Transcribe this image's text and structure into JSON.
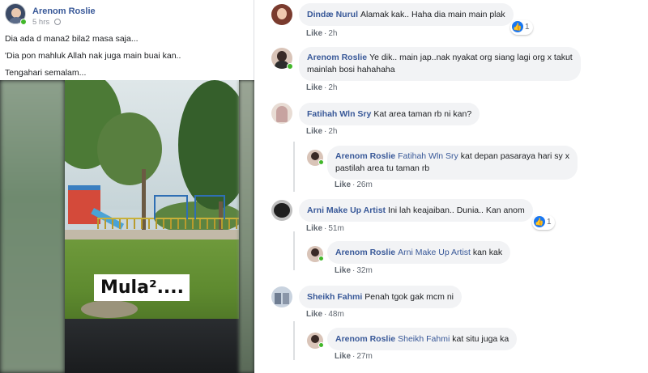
{
  "post": {
    "author": "Arenom Roslie",
    "time": "5 hrs",
    "privacy_icon": "globe-icon",
    "lines": [
      "Dia ada d mana2 bila2 masa saja...",
      "'Dia pon mahluk Allah nak juga main buai kan..",
      "Tengahari semalam..."
    ],
    "video_caption": "Mula²...."
  },
  "comments": [
    {
      "name": "Dindæ Nurul",
      "text": "Alamak kak.. Haha dia main main plak",
      "like": "Like",
      "time": "2h",
      "reactions": "1"
    },
    {
      "name": "Arenom Roslie",
      "line1": "Ye dik.. main jap..nak nyakat org siang lagi org x takut",
      "line2": "mainlah bosi hahahaha",
      "like": "Like",
      "time": "2h"
    },
    {
      "name": "Fatihah Wln Sry",
      "text": "Kat area taman rb ni kan?",
      "like": "Like",
      "time": "2h"
    },
    {
      "name": "Arenom Roslie",
      "tag": "Fatihah Wln Sry",
      "line1": "kat depan pasaraya hari sy x",
      "line2": "pastilah area tu taman rb",
      "like": "Like",
      "time": "26m"
    },
    {
      "name": "Arni Make Up Artist",
      "text": "Ini lah keajaiban.. Dunia.. Kan anom",
      "like": "Like",
      "time": "51m",
      "reactions": "1"
    },
    {
      "name": "Arenom Roslie",
      "tag": "Arni Make Up Artist",
      "text": "kan kak",
      "like": "Like",
      "time": "32m"
    },
    {
      "name": "Sheikh Fahmi",
      "text": "Penah tgok gak mcm ni",
      "like": "Like",
      "time": "48m"
    },
    {
      "name": "Arenom Roslie",
      "tag": "Sheikh Fahmi",
      "text": "kat situ juga ka",
      "like": "Like",
      "time": "27m"
    }
  ],
  "colors": {
    "link": "#385898",
    "bubble": "#f2f3f5",
    "online": "#42b72a",
    "like_blue": "#1877f2"
  }
}
